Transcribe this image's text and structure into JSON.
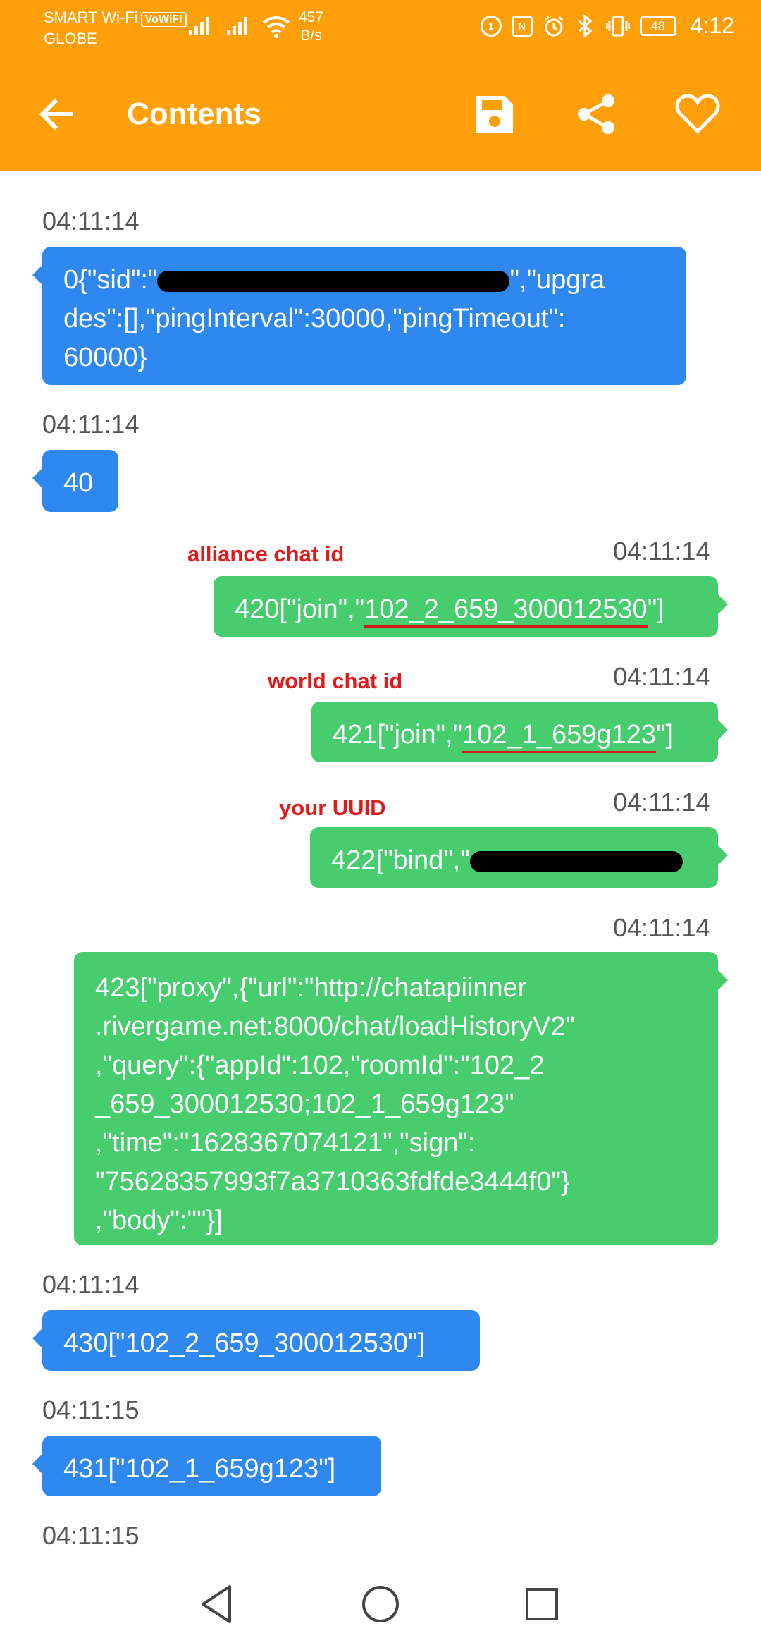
{
  "status_bar": {
    "carrier_line1": "SMART Wi-Fi",
    "vowifi": "VoWiFi",
    "carrier_line2": "GLOBE",
    "speed_value": "457",
    "speed_unit": "B/s",
    "battery": "48",
    "time": "4:12"
  },
  "app_bar": {
    "title": "Contents",
    "icons": [
      "back-arrow-icon",
      "save-icon",
      "share-icon",
      "heart-icon"
    ]
  },
  "messages": [
    {
      "time": "04:11:14",
      "direction": "in",
      "lines": [
        "0{\"sid\":\"",
        "des\":[],\"pingInterval\":30000,\"pingTimeout\":",
        "60000}"
      ],
      "line1_tail": "\",\"upgra"
    },
    {
      "time": "04:11:14",
      "direction": "in",
      "text": "40"
    },
    {
      "time": "04:11:14",
      "direction": "out",
      "note": "alliance chat id",
      "prefix": "420[\"join\",\"",
      "highlight": "102_2_659_300012530",
      "suffix": "\"]"
    },
    {
      "time": "04:11:14",
      "direction": "out",
      "note": "world chat id",
      "prefix": "421[\"join\",\"",
      "highlight": "102_1_659g123",
      "suffix": "\"]"
    },
    {
      "time": "04:11:14",
      "direction": "out",
      "note": "your UUID",
      "prefix": "422[\"bind\",\"",
      "suffix": "\"]"
    },
    {
      "time": "04:11:14",
      "direction": "out",
      "text": "423[\"proxy\",{\"url\":\"http://chatapiinner\n.rivergame.net:8000/chat/loadHistoryV2\"\n,\"query\":{\"appId\":102,\"roomId\":\"102_2\n_659_300012530;102_1_659g123\"\n,\"time\":\"1628367074121\",\"sign\":\n\"75628357993f7a3710363fdfde3444f0\"}\n,\"body\":\"\"}]"
    },
    {
      "time": "04:11:14",
      "direction": "in",
      "text": "430[\"102_2_659_300012530\"]"
    },
    {
      "time": "04:11:15",
      "direction": "in",
      "text": "431[\"102_1_659g123\"]"
    },
    {
      "time": "04:11:15"
    }
  ],
  "colors": {
    "app_bar": "#FF9F0A",
    "incoming_bubble": "#2F88F0",
    "outgoing_bubble": "#47CC6E",
    "annotation": "#E0191C"
  }
}
